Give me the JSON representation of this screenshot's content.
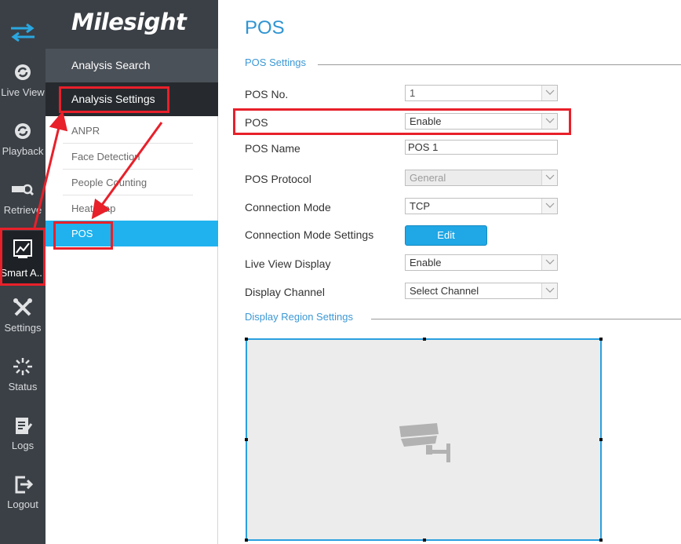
{
  "rail": {
    "items": [
      {
        "label": "Live View",
        "icon": "live-view-icon"
      },
      {
        "label": "Playback",
        "icon": "playback-icon"
      },
      {
        "label": "Retrieve",
        "icon": "retrieve-icon"
      },
      {
        "label": "Smart A...",
        "icon": "smart-analysis-icon"
      },
      {
        "label": "Settings",
        "icon": "settings-icon"
      },
      {
        "label": "Status",
        "icon": "status-icon"
      },
      {
        "label": "Logs",
        "icon": "logs-icon"
      },
      {
        "label": "Logout",
        "icon": "logout-icon"
      }
    ]
  },
  "brand": {
    "name": "Milesight"
  },
  "nav": {
    "analysis_search": "Analysis Search",
    "analysis_settings": "Analysis Settings",
    "sub_items": [
      "ANPR",
      "Face Detection",
      "People Counting",
      "Heat Map",
      "POS"
    ]
  },
  "page": {
    "title": "POS",
    "pos_settings_title": "POS Settings",
    "display_region_title": "Display Region Settings"
  },
  "form": {
    "pos_no": {
      "label": "POS No.",
      "value": "1"
    },
    "pos": {
      "label": "POS",
      "value": "Enable"
    },
    "pos_name": {
      "label": "POS Name",
      "value": "POS 1"
    },
    "pos_protocol": {
      "label": "POS Protocol",
      "value": "General"
    },
    "connection_mode": {
      "label": "Connection Mode",
      "value": "TCP"
    },
    "connection_mode_settings": {
      "label": "Connection Mode Settings",
      "button": "Edit"
    },
    "live_view_display": {
      "label": "Live View Display",
      "value": "Enable"
    },
    "display_channel": {
      "label": "Display Channel",
      "value": "Select Channel"
    }
  },
  "colors": {
    "accent": "#1fb2ee",
    "highlight": "#e8202a",
    "rail": "#3b4046"
  }
}
